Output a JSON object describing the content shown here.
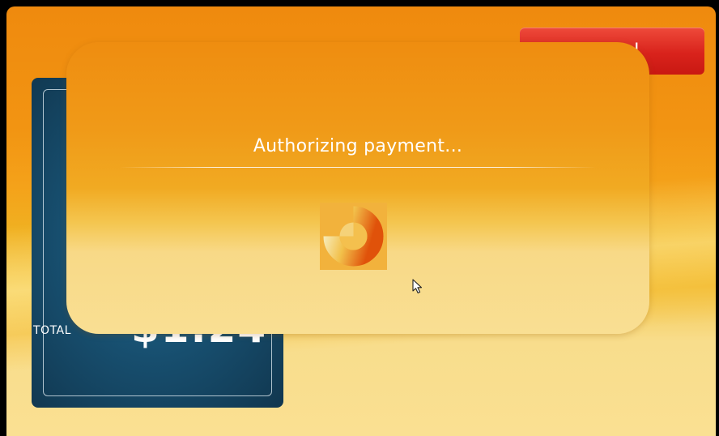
{
  "header": {
    "cancel_label": "Cancel",
    "cancel_icon": "×"
  },
  "summary": {
    "total_label": "TOTAL",
    "total_amount": "$1.24"
  },
  "dialog": {
    "title": "Authorizing payment..."
  },
  "colors": {
    "background_top": "#ef8a0e",
    "background_bottom": "#fae092",
    "cancel_red": "#d9231c",
    "card_blue": "#174e6e",
    "spinner_orange": "#e8600a",
    "spinner_light": "#f5e6a8"
  },
  "icons": {
    "spinner": "loading-spinner-icon",
    "cursor": "mouse-pointer-icon",
    "cancel": "close-icon"
  }
}
